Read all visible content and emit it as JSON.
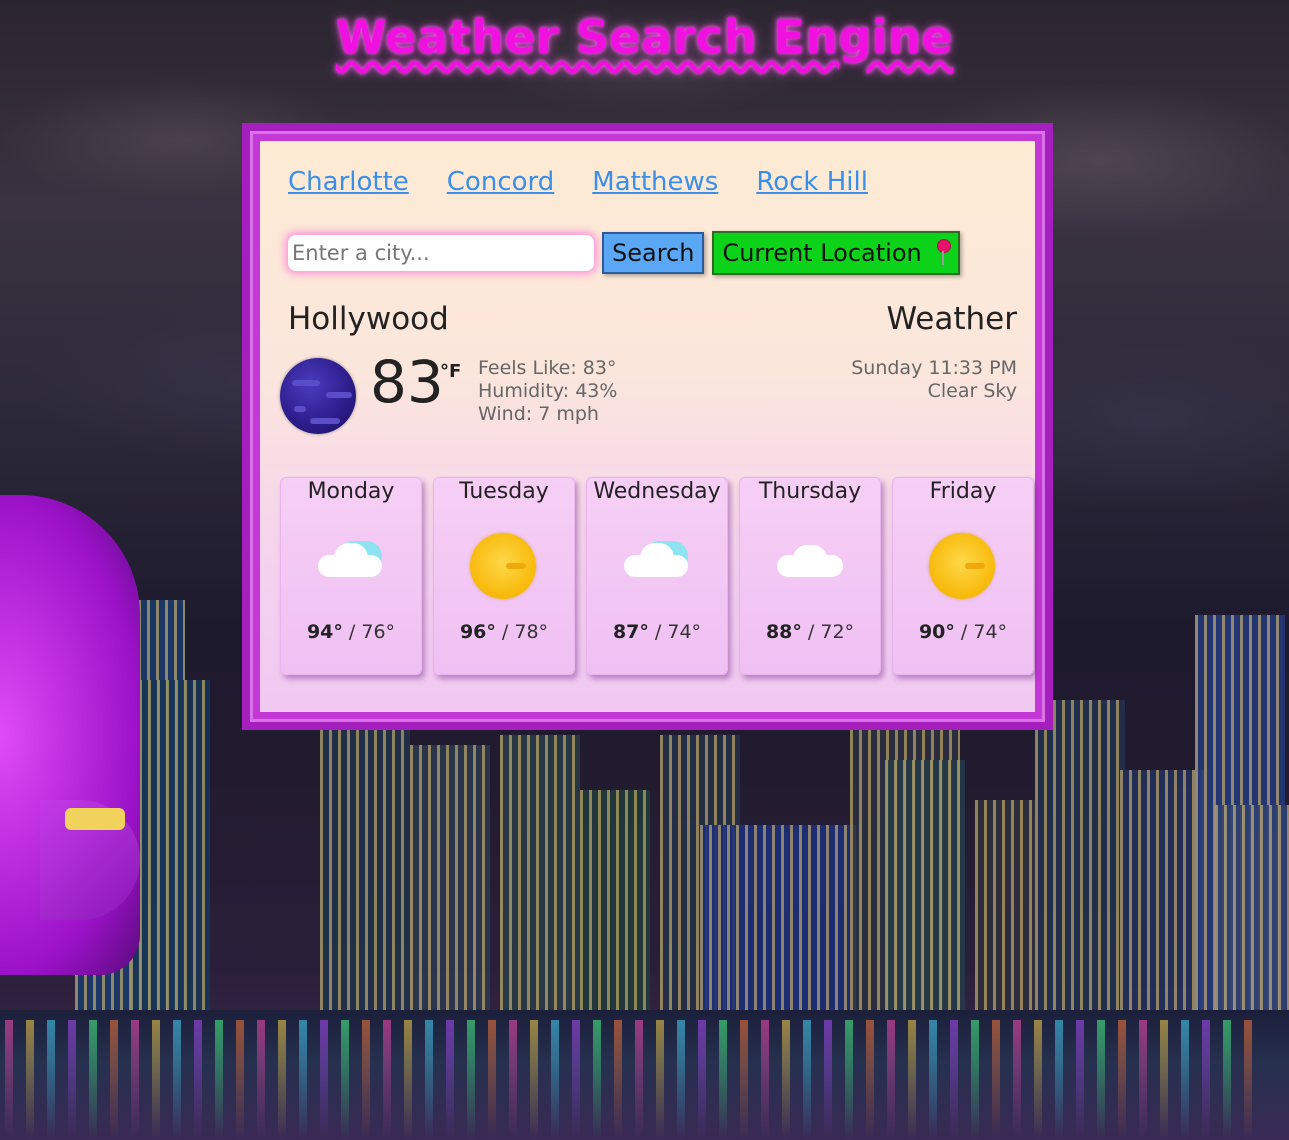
{
  "page": {
    "title": "Weather Search Engine"
  },
  "quick_cities": [
    "Charlotte",
    "Concord",
    "Matthews",
    "Rock Hill"
  ],
  "search": {
    "placeholder": "Enter a city...",
    "value": "",
    "search_label": "Search",
    "location_label": "Current Location",
    "location_icon": "pushpin-icon"
  },
  "current": {
    "city": "Hollywood",
    "heading": "Weather",
    "temperature": "83",
    "unit": "°F",
    "icon": "clear-night-moon-icon",
    "feels_like": "Feels Like: 83°",
    "humidity": "Humidity: 43%",
    "wind": "Wind: 7 mph",
    "datetime": "Sunday 11:33 PM",
    "description": "Clear Sky"
  },
  "forecast": [
    {
      "day": "Monday",
      "high": "94°",
      "low": "76°",
      "icon": "partly-cloudy-icon"
    },
    {
      "day": "Tuesday",
      "high": "96°",
      "low": "78°",
      "icon": "sun-icon"
    },
    {
      "day": "Wednesday",
      "high": "87°",
      "low": "74°",
      "icon": "partly-cloudy-icon"
    },
    {
      "day": "Thursday",
      "high": "88°",
      "low": "72°",
      "icon": "cloud-icon"
    },
    {
      "day": "Friday",
      "high": "90°",
      "low": "74°",
      "icon": "sun-icon"
    }
  ],
  "colors": {
    "title": "#f010e0",
    "frame": "#c338d6",
    "link": "#3b8fe8",
    "search_button": "#5aa8f5",
    "location_button": "#0cd31a"
  }
}
